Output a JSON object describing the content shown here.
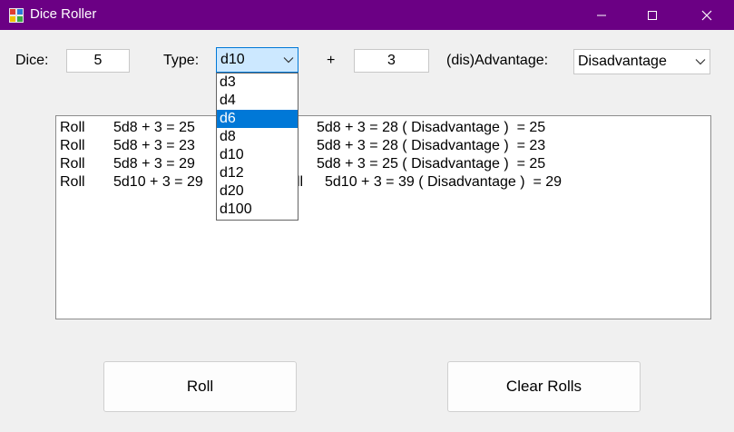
{
  "window": {
    "title": "Dice Roller"
  },
  "controls": {
    "dice_label": "Dice:",
    "dice_value": "5",
    "type_label": "Type:",
    "type_value": "d10",
    "plus_label": "+",
    "modifier_value": "3",
    "advantage_label": "(dis)Advantage:",
    "advantage_value": "Disadvantage"
  },
  "type_dropdown": {
    "options": [
      "d3",
      "d4",
      "d6",
      "d8",
      "d10",
      "d12",
      "d20",
      "d100"
    ],
    "highlighted": "d6"
  },
  "rolls": [
    {
      "label": "Roll",
      "expr": "5d8 + 3 = 25",
      "tail": "5d8 + 3 = 28 ( Disadvantage )  = 25"
    },
    {
      "label": "Roll",
      "expr": "5d8 + 3 = 23",
      "tail": "5d8 + 3 = 28 ( Disadvantage )  = 23"
    },
    {
      "label": "Roll",
      "expr": "5d8 + 3 = 29",
      "tail": "5d8 + 3 = 25 ( Disadvantage )  = 25"
    },
    {
      "label": "Roll",
      "expr": "5d10 + 3 = 29",
      "partial": "ll",
      "tail": "5d10 + 3 = 39 ( Disadvantage )  = 29"
    }
  ],
  "buttons": {
    "roll": "Roll",
    "clear": "Clear Rolls"
  },
  "colors": {
    "titlebar": "#6b0084",
    "selection": "#0078d7",
    "type_select_bg": "#cce8ff",
    "type_select_border": "#0078d7"
  }
}
